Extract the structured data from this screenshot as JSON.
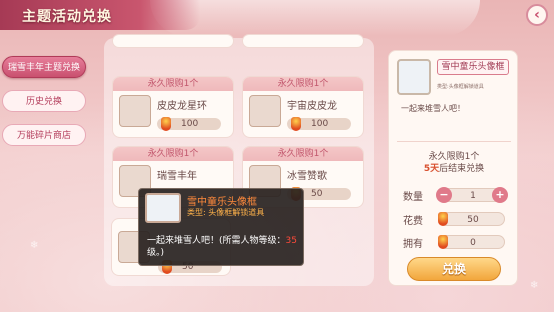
{
  "header": {
    "title": "主题活动兑换",
    "back_icon": "back-arrow-icon"
  },
  "sidebar": {
    "items": [
      {
        "label": "瑞雪丰年主题兑换",
        "active": true
      },
      {
        "label": "历史兑换",
        "active": false
      },
      {
        "label": "万能碎片商店",
        "active": false
      }
    ]
  },
  "grid": {
    "cards": [
      {
        "header": "永久限购1个",
        "name": "皮皮龙星环",
        "price": "100"
      },
      {
        "header": "永久限购1个",
        "name": "宇宙皮皮龙",
        "price": "100"
      },
      {
        "header": "永久限购1个",
        "name": "瑞雪丰年",
        "price": ""
      },
      {
        "header": "永久限购1个",
        "name": "冰雪赞歌",
        "price": "50"
      },
      {
        "header": "",
        "name": "",
        "price": "50"
      }
    ]
  },
  "detail": {
    "name": "雪中童乐头像框",
    "type_label": "类型:",
    "type_value": "头像框解锁道具",
    "description": "一起来堆雪人吧！",
    "limit": "永久限购1个",
    "end_days": "5天",
    "end_suffix": "后结束兑换",
    "qty_label": "数量",
    "qty_value": "1",
    "cost_label": "花费",
    "cost_value": "50",
    "own_label": "拥有",
    "own_value": "0",
    "exchange_label": "兑换"
  },
  "tooltip": {
    "name": "雪中童乐头像框",
    "type": "类型: 头像框解锁道具",
    "desc_prefix": "一起来堆雪人吧！(所需人物等级：",
    "desc_level": "35",
    "desc_suffix": "级。)"
  },
  "colors": {
    "accent": "#c9506f",
    "coin": "#e04a1f",
    "tooltip_name": "#ff8a3c",
    "level_red": "#ff4a3a"
  }
}
